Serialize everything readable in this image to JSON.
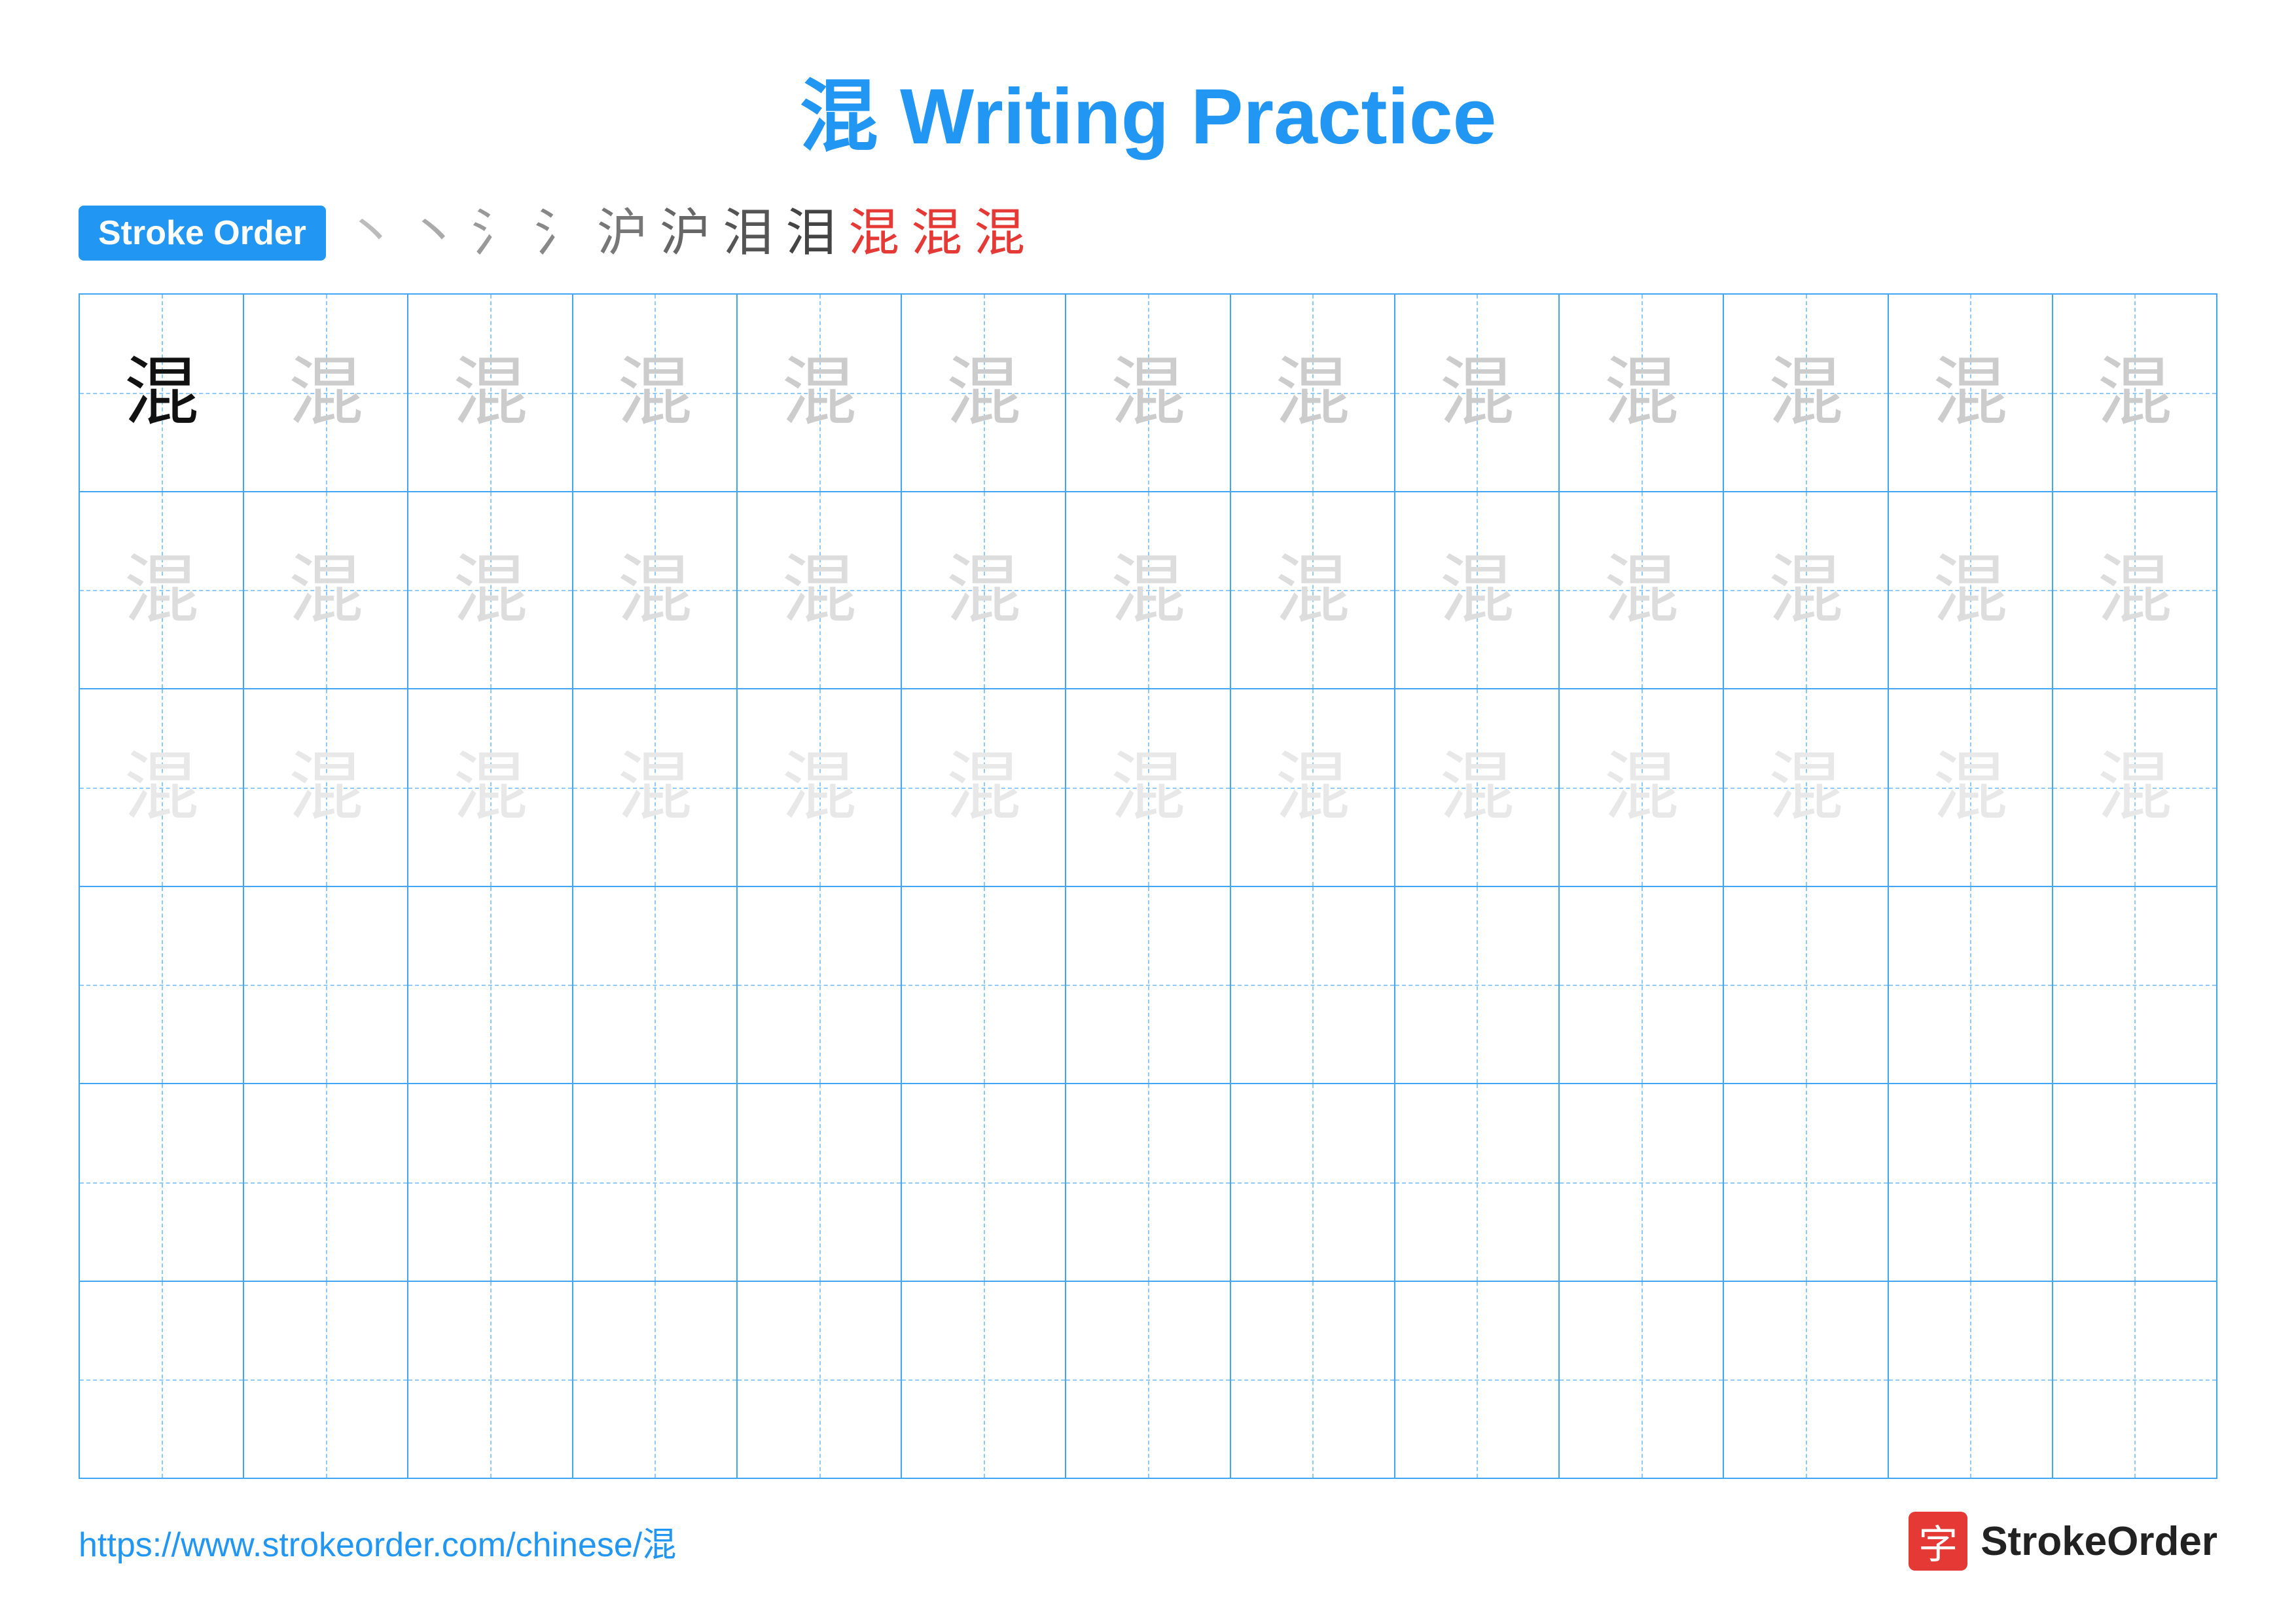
{
  "title": "混 Writing Practice",
  "stroke_order": {
    "badge_label": "Stroke Order",
    "strokes": [
      "丶",
      "丶",
      "氵",
      "氵",
      "沪",
      "沪",
      "泪",
      "泪",
      "混",
      "混",
      "混"
    ]
  },
  "character": "混",
  "grid": {
    "rows": 6,
    "cols": 13,
    "row_types": [
      "solid",
      "light1",
      "light2",
      "empty",
      "empty",
      "empty"
    ]
  },
  "footer": {
    "url": "https://www.strokeorder.com/chinese/混",
    "logo_icon": "字",
    "logo_text": "StrokeOrder"
  }
}
